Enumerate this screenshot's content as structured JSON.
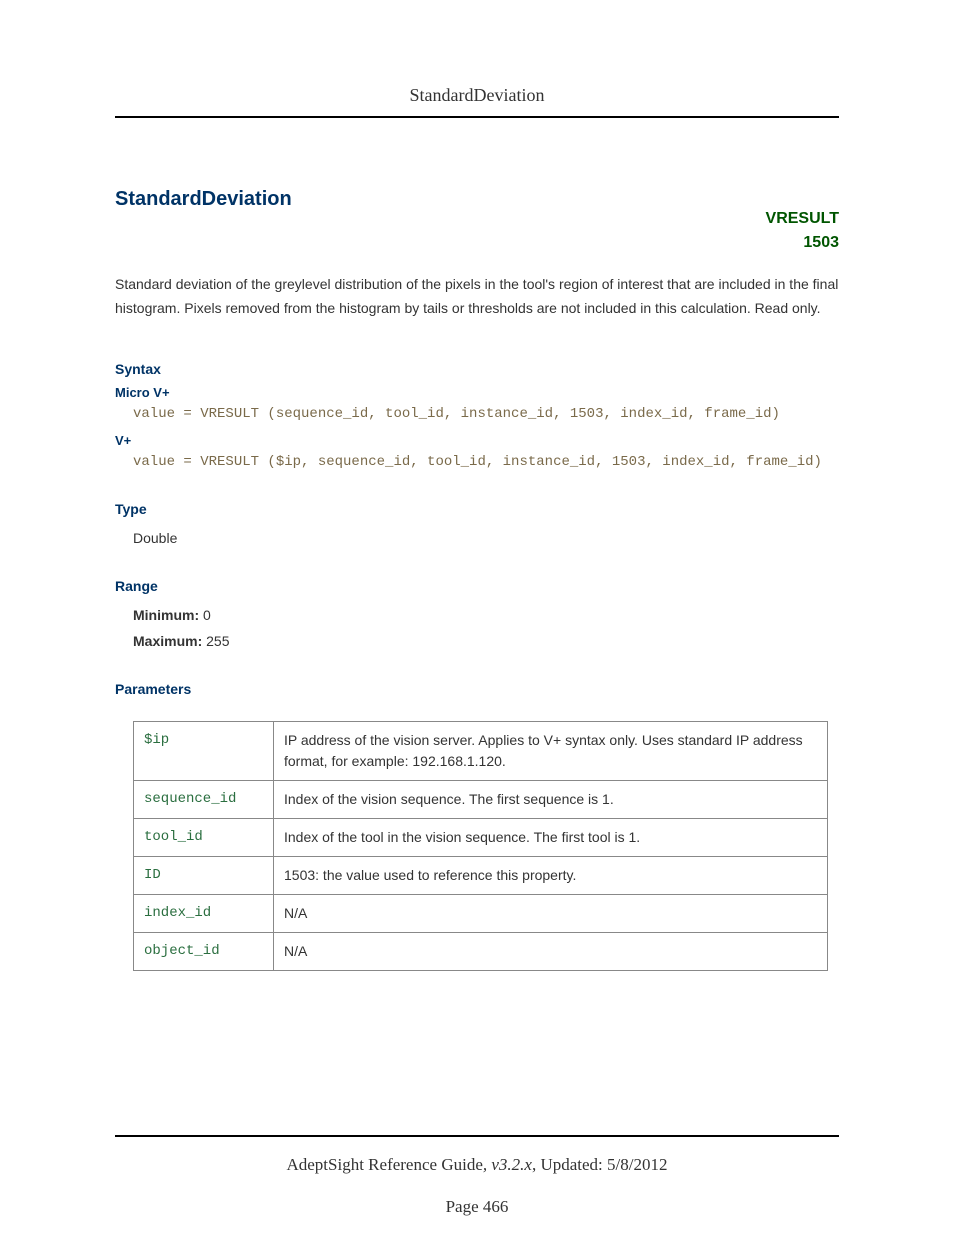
{
  "header": {
    "running_title": "StandardDeviation"
  },
  "title": "StandardDeviation",
  "badge": {
    "line1": "VRESULT",
    "line2": "1503"
  },
  "description": "Standard deviation of the greylevel distribution of the pixels in the tool's region of interest that are included in the final histogram. Pixels removed from the histogram by tails or thresholds are not included in this calculation. Read only.",
  "syntax": {
    "heading": "Syntax",
    "micro_label": "Micro V+",
    "micro_code": "value = VRESULT (sequence_id, tool_id, instance_id, 1503, index_id, frame_id)",
    "vplus_label": "V+",
    "vplus_code": "value = VRESULT ($ip, sequence_id, tool_id, instance_id, 1503, index_id, frame_id)"
  },
  "type": {
    "heading": "Type",
    "value": "Double"
  },
  "range": {
    "heading": "Range",
    "min_label": "Minimum:",
    "min_value": "0",
    "max_label": "Maximum:",
    "max_value": "255"
  },
  "parameters": {
    "heading": "Parameters",
    "rows": [
      {
        "name": "$ip",
        "desc": "IP address of the vision server. Applies to V+ syntax only. Uses standard IP address format, for example: 192.168.1.120."
      },
      {
        "name": "sequence_id",
        "desc": "Index of the vision sequence. The first sequence is 1."
      },
      {
        "name": "tool_id",
        "desc": "Index of the tool in the vision sequence. The first tool is 1."
      },
      {
        "name": "ID",
        "desc": "1503: the value used to reference this property."
      },
      {
        "name": "index_id",
        "desc": "N/A"
      },
      {
        "name": "object_id",
        "desc": "N/A"
      }
    ]
  },
  "footer": {
    "guide": "AdeptSight Reference Guide",
    "version": "v3.2.x",
    "updated_label": "Updated:",
    "updated": "5/8/2012",
    "page_label": "Page",
    "page_number": "466"
  }
}
